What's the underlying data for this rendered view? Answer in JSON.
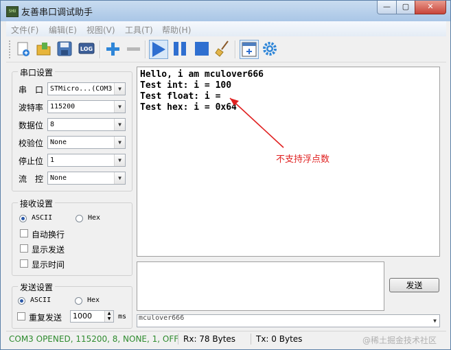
{
  "window": {
    "title": "友善串口调试助手",
    "app_icon_text": "SHU",
    "controls": {
      "minimize": "—",
      "maximize": "▢",
      "close": "✕"
    }
  },
  "menu": [
    {
      "label": "文件(F)"
    },
    {
      "label": "编辑(E)"
    },
    {
      "label": "视图(V)"
    },
    {
      "label": "工具(T)"
    },
    {
      "label": "帮助(H)"
    }
  ],
  "toolbar": {
    "log_label": "LOG"
  },
  "serial_settings": {
    "title": "串口设置",
    "port": {
      "label": "串　口",
      "value": "STMicro...(COM3"
    },
    "baud": {
      "label": "波特率",
      "value": "115200"
    },
    "databits": {
      "label": "数据位",
      "value": "8"
    },
    "parity": {
      "label": "校验位",
      "value": "None"
    },
    "stopbits": {
      "label": "停止位",
      "value": "1"
    },
    "flow": {
      "label": "流　控",
      "value": "None"
    }
  },
  "receive_settings": {
    "title": "接收设置",
    "ascii": "ASCII",
    "hex": "Hex",
    "auto_wrap": "自动换行",
    "show_send": "显示发送",
    "show_time": "显示时间"
  },
  "send_settings": {
    "title": "发送设置",
    "ascii": "ASCII",
    "hex": "Hex",
    "repeat": "重复发送",
    "interval": "1000",
    "unit": "ms"
  },
  "receive_lines": [
    "Hello, i am mculover666",
    "Test int: i = 100",
    "Test float: i = ",
    "Test hex: i = 0x64"
  ],
  "annotation": "不支持浮点数",
  "send_button": "发送",
  "history_value": "mculover666",
  "status": {
    "port_state": "COM3 OPENED, 115200, 8, NONE, 1, OFF",
    "rx": "Rx: 78 Bytes",
    "tx": "Tx: 0 Bytes"
  },
  "watermark": "@稀土掘金技术社区",
  "colors": {
    "status_green": "#2e8b2e",
    "annotation_red": "#e02020",
    "accent_blue": "#2a6fd6"
  }
}
